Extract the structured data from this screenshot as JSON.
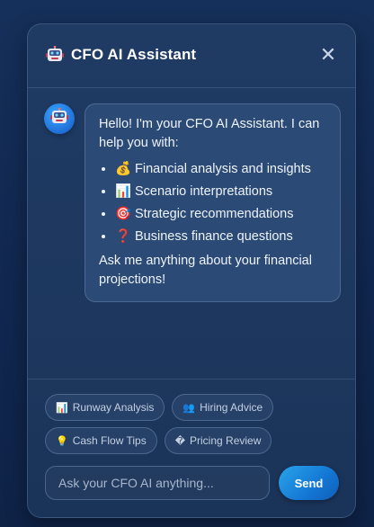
{
  "header": {
    "icon": "robot-icon",
    "title": "CFO AI Assistant",
    "close_label": "✕"
  },
  "message": {
    "avatar_icon": "robot-icon",
    "intro": "Hello! I'm your CFO AI Assistant. I can help you with:",
    "items": [
      {
        "emoji": "💰",
        "text": "Financial analysis and insights"
      },
      {
        "emoji": "📊",
        "text": "Scenario interpretations"
      },
      {
        "emoji": "🎯",
        "text": "Strategic recommendations"
      },
      {
        "emoji": "❓",
        "text": "Business finance questions"
      }
    ],
    "outro": "Ask me anything about your financial projections!"
  },
  "quick_actions": [
    {
      "emoji": "📊",
      "label": "Runway Analysis"
    },
    {
      "emoji": "👥",
      "label": "Hiring Advice"
    },
    {
      "emoji": "💡",
      "label": "Cash Flow Tips"
    },
    {
      "emoji": "�",
      "label": "Pricing Review"
    }
  ],
  "input": {
    "placeholder": "Ask your CFO AI anything...",
    "value": ""
  },
  "send_label": "Send",
  "colors": {
    "background": "#12284a",
    "panel": "#1f3b64",
    "bubble": "#2b4a75",
    "accent": "#1e8de0"
  }
}
